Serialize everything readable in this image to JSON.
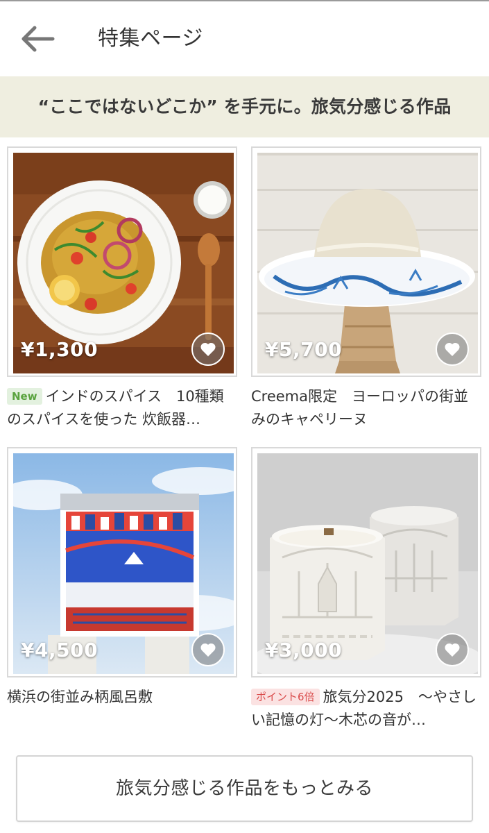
{
  "header": {
    "title": "特集ページ",
    "back_icon": "arrow-left-icon"
  },
  "feature": {
    "heading": "“ここではないどこか” を手元に。旅気分感じる作品"
  },
  "products": [
    {
      "price": "¥1,300",
      "badge": "New",
      "title": "インドのスパイス　10種類のスパイスを使った 炊飯器…",
      "image": "spice-rice-plate"
    },
    {
      "price": "¥5,700",
      "badge": "",
      "title": "Creema限定　ヨーロッパの街並みのキャペリーヌ",
      "image": "capeline-hat"
    },
    {
      "price": "¥4,500",
      "badge": "",
      "title": "横浜の街並み柄風呂敷",
      "image": "furoshiki-cloth"
    },
    {
      "price": "¥3,000",
      "badge": "ポイント6倍",
      "title": "旅気分2025　～やさしい記憶の灯～木芯の音が…",
      "image": "architecture-candles"
    }
  ],
  "more_button": {
    "label": "旅気分感じる作品をもっとみる"
  },
  "colors": {
    "banner_bg": "#efeee0",
    "new_badge": "#5aa33f",
    "point_badge": "#d94a4a"
  }
}
